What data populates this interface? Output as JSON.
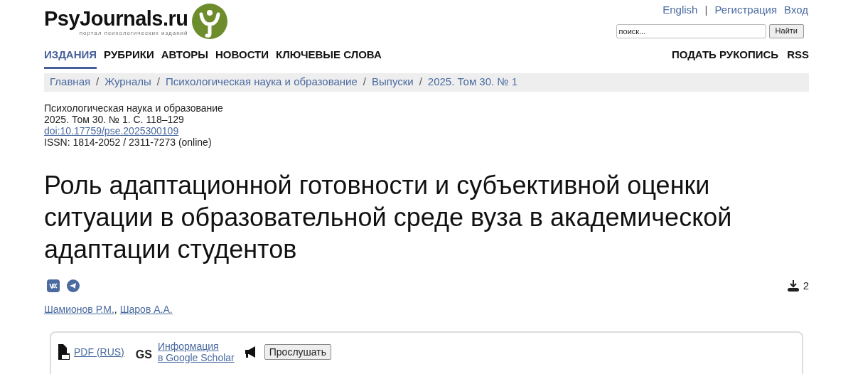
{
  "logo": {
    "name": "PsyJournals.ru",
    "tagline": "портал психологических изданий"
  },
  "top_links": [
    {
      "label": "English"
    },
    {
      "label": "|",
      "kind": "separator"
    },
    {
      "label": "Регистрация"
    },
    {
      "label": "Вход"
    }
  ],
  "search": {
    "placeholder": "поиск...",
    "button": "Найти"
  },
  "nav": [
    {
      "label": "ИЗДАНИЯ",
      "selected": true
    },
    {
      "label": "РУБРИКИ",
      "selected": false
    },
    {
      "label": "АВТОРЫ",
      "selected": false
    },
    {
      "label": "НОВОСТИ",
      "selected": false
    },
    {
      "label": "КЛЮЧЕВЫЕ СЛОВА",
      "selected": false
    }
  ],
  "nav_right": [
    "ПОДАТЬ РУКОПИСЬ",
    "RSS"
  ],
  "breadcrumbs": [
    {
      "kind": "link",
      "label": "Главная"
    },
    {
      "kind": "separator",
      "label": "/"
    },
    {
      "kind": "link",
      "label": "Журналы"
    },
    {
      "kind": "separator",
      "label": "/"
    },
    {
      "kind": "link",
      "label": "Психологическая наука и образование"
    },
    {
      "kind": "separator",
      "label": "/"
    },
    {
      "kind": "link",
      "label": "Выпуски"
    },
    {
      "kind": "separator",
      "label": "/"
    },
    {
      "kind": "link",
      "label": "2025. Том 30. № 1"
    }
  ],
  "meta": {
    "journal": "Психологическая наука и образование",
    "issue": "2025. Том 30. № 1. С. 118–129",
    "doi": "doi:10.17759/pse.2025300109",
    "issn": "ISSN: 1814-2052 / 2311-7273 (online)"
  },
  "title": "Роль адаптационной готовности и субъективной оценки ситуации в образовательной среде вуза в академической адаптации студентов",
  "downloads": "2",
  "authors": [
    {
      "kind": "link",
      "label": "Шамионов Р.М."
    },
    {
      "kind": "separator",
      "label": ","
    },
    {
      "kind": "link",
      "label": "Шаров А.А."
    }
  ],
  "actions": {
    "pdf": "PDF (RUS)",
    "gs_mark": "GS",
    "scholar": [
      "Информация",
      "в Google Scholar"
    ],
    "listen": "Прослушать"
  }
}
